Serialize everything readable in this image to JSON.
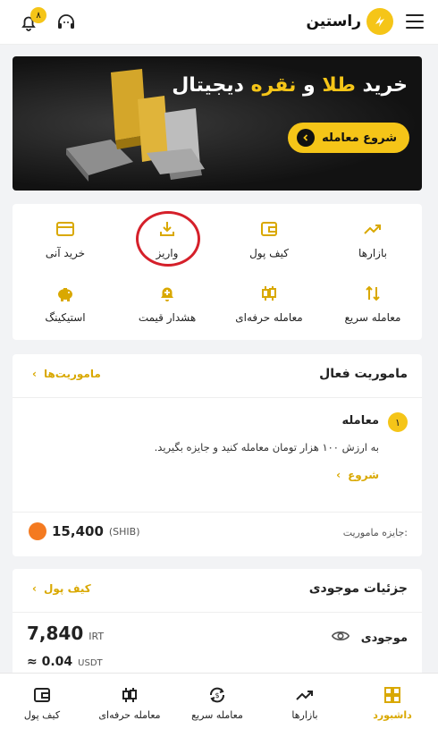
{
  "header": {
    "brand": "راستین",
    "notification_count": "۸"
  },
  "banner": {
    "title_part1": "خرید ",
    "title_gold": "طلا",
    "title_part2": " و ",
    "title_silver": "نقره",
    "title_part3": " دیجیتال",
    "button_label": "شروع معامله"
  },
  "quick_actions": {
    "markets": "بازارها",
    "wallet": "کیف پول",
    "deposit": "واریز",
    "instant_buy": "خرید آنی",
    "quick_trade": "معامله سریع",
    "pro_trade": "معامله حرفه‌ای",
    "price_alert": "هشدار قیمت",
    "staking": "استیکینگ"
  },
  "missions": {
    "title": "ماموریت فعال",
    "link": "ماموریت‌ها",
    "step_number": "۱",
    "mission_title": "معامله",
    "mission_desc": "به ارزش ۱۰۰ هزار تومان معامله کنید و جایزه بگیرید.",
    "start_label": "شروع",
    "reward_label": "جایزه ماموریت:",
    "reward_value": "15,400",
    "reward_unit": "(SHIB)"
  },
  "balance": {
    "title": "جزئیات موجودی",
    "wallet_link": "کیف پول",
    "label": "موجودی",
    "irt_value": "7,840",
    "irt_unit": "IRT",
    "usdt_value": "≈ 0.04",
    "usdt_unit": "USDT"
  },
  "bottom_nav": {
    "dashboard": "داشبورد",
    "markets": "بازارها",
    "quick_trade": "معامله سریع",
    "pro_trade": "معامله حرفه‌ای",
    "wallet": "کیف پول"
  },
  "colors": {
    "accent": "#f5c518",
    "accent_text": "#d9a800",
    "annotation_circle": "#d5202a"
  }
}
